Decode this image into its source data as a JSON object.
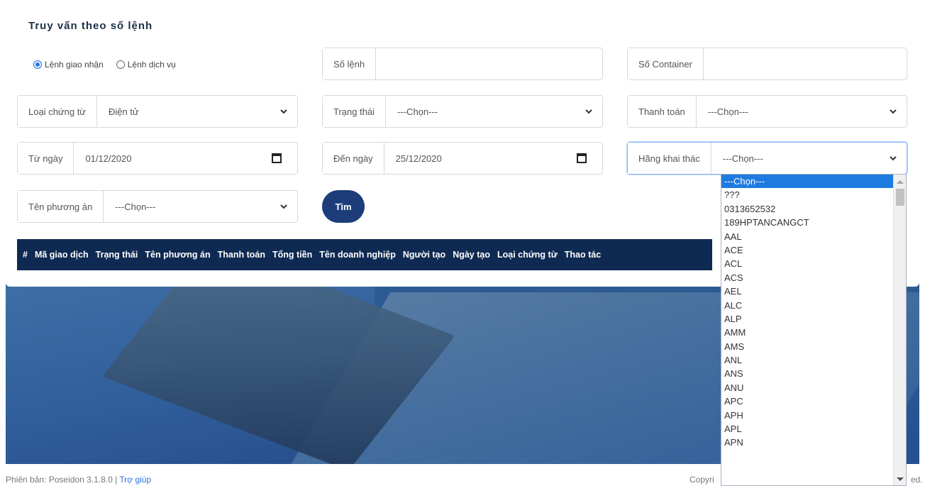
{
  "form": {
    "title": "Truy vấn theo số lệnh",
    "radio": [
      {
        "label": "Lệnh giao nhận",
        "checked": true
      },
      {
        "label": "Lệnh dịch vụ",
        "checked": false
      }
    ],
    "so_lenh": {
      "label": "Số lệnh",
      "value": ""
    },
    "so_container": {
      "label": "Số Container",
      "value": ""
    },
    "loai_chung_tu": {
      "label": "Loại chứng từ",
      "value": "Điện tử"
    },
    "trang_thai": {
      "label": "Trạng thái",
      "value": "---Chọn---"
    },
    "thanh_toan": {
      "label": "Thanh toán",
      "value": "---Chọn---"
    },
    "tu_ngay": {
      "label": "Từ ngày",
      "value": "01/12/2020"
    },
    "den_ngay": {
      "label": "Đến ngày",
      "value": "25/12/2020"
    },
    "hang_khai_thac": {
      "label": "Hãng khai thác",
      "value": "---Chọn---"
    },
    "ten_phuong_an": {
      "label": "Tên phương án",
      "value": "---Chọn---"
    },
    "find_button": "Tìm"
  },
  "table": {
    "headers": [
      "#",
      "Mã giao dịch",
      "Trạng thái",
      "Tên phương án",
      "Thanh toán",
      "Tổng tiền",
      "Tên doanh nghiệp",
      "Người tạo",
      "Ngày tạo",
      "Loại chứng từ",
      "Thao tác"
    ]
  },
  "dropdown": {
    "options": [
      "---Chọn---",
      "???",
      "0313652532",
      "189HPTANCANGCT",
      "AAL",
      "ACE",
      "ACL",
      "ACS",
      "AEL",
      "ALC",
      "ALP",
      "AMM",
      "AMS",
      "ANL",
      "ANS",
      "ANU",
      "APC",
      "APH",
      "APL",
      "APN"
    ],
    "selected_index": 0
  },
  "footer": {
    "version": "Phiên bản: Poseidon 3.1.8.0 | ",
    "help": "Trợ giúp",
    "copyright_left": "Copyri",
    "copyright_right": "ed."
  },
  "colors": {
    "primary_dark": "#0f2a52",
    "button": "#1c3d7a",
    "selected_option": "#1e7be0",
    "accent": "#2a72d8"
  }
}
